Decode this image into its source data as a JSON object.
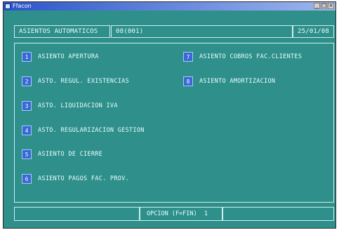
{
  "window": {
    "title": "Ffacon"
  },
  "header": {
    "screen_title": "ASIENTOS AUTOMATICOS",
    "company_code": "08(001)",
    "date": "25/01/08"
  },
  "menu": {
    "left_items": [
      {
        "key": "1",
        "label": "ASIENTO APERTURA"
      },
      {
        "key": "2",
        "label": "ASTO. REGUL. EXISTENCIAS"
      },
      {
        "key": "3",
        "label": "ASTO. LIQUIDACION IVA"
      },
      {
        "key": "4",
        "label": "ASTO. REGULARIZACION GESTION"
      },
      {
        "key": "5",
        "label": "ASIENTO DE CIERRE"
      },
      {
        "key": "6",
        "label": "ASIENTO PAGOS FAC. PROV."
      }
    ],
    "right_items": [
      {
        "key": "7",
        "label": "ASIENTO COBROS FAC.CLIENTES"
      },
      {
        "key": "8",
        "label": "ASIENTO AMORTIZACION"
      }
    ]
  },
  "status": {
    "prompt": "OPCION (F=FIN)",
    "value": "1"
  },
  "icons": {
    "app": "app-icon",
    "minimize": "minimize-icon",
    "maximize": "maximize-icon",
    "close": "close-icon"
  },
  "colors": {
    "background": "#2e8f8b",
    "key_fill": "#3b66d6",
    "text": "#eaffff"
  }
}
